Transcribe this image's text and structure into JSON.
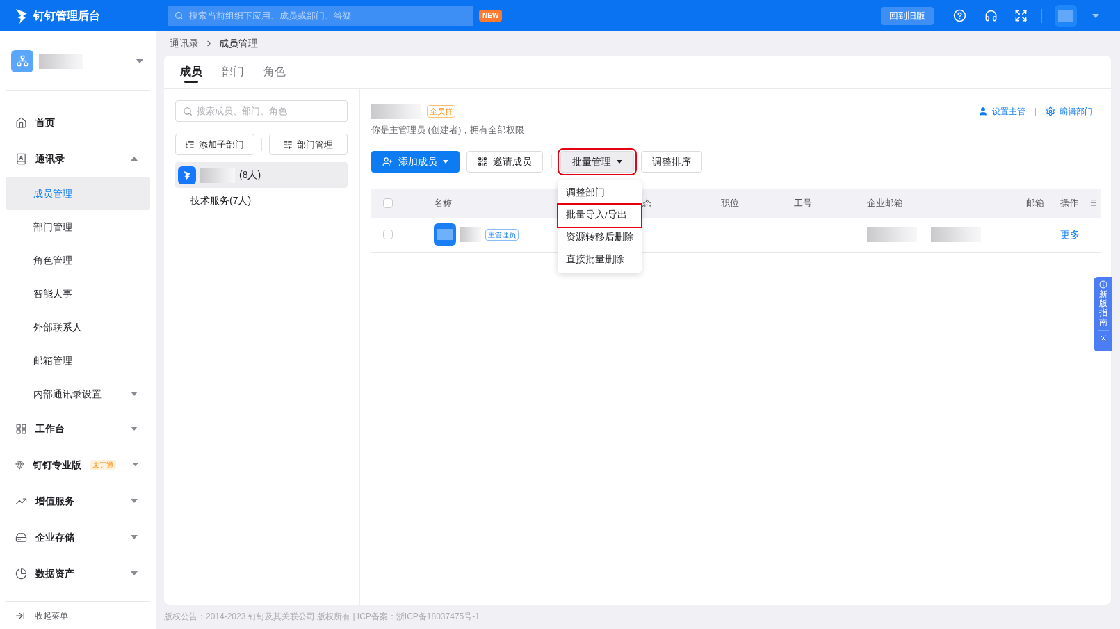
{
  "header": {
    "title": "钉钉管理后台",
    "search": {
      "placeholder": "搜索当前组织下应用、成员或部门、答疑"
    },
    "new_badge": "NEW",
    "old_version_button": "回到旧版"
  },
  "sidebar": {
    "items": [
      {
        "label": "首页",
        "kind": "link",
        "selected": false
      },
      {
        "label": "通讯录",
        "kind": "group",
        "expanded": true,
        "children": [
          {
            "label": "成员管理",
            "kind": "link",
            "selected": true
          },
          {
            "label": "部门管理",
            "kind": "link",
            "selected": false
          },
          {
            "label": "角色管理",
            "kind": "link",
            "selected": false
          },
          {
            "label": "智能人事",
            "kind": "link",
            "selected": false
          },
          {
            "label": "外部联系人",
            "kind": "link",
            "selected": false
          },
          {
            "label": "邮箱管理",
            "kind": "link",
            "selected": false
          },
          {
            "label": "内部通讯录设置",
            "kind": "group",
            "expanded": false
          }
        ]
      },
      {
        "label": "工作台",
        "kind": "group",
        "expanded": false
      },
      {
        "label": "钉钉专业版",
        "kind": "group",
        "expanded": false,
        "badge": "未开通"
      },
      {
        "label": "增值服务",
        "kind": "group",
        "expanded": false
      },
      {
        "label": "企业存储",
        "kind": "group",
        "expanded": false
      },
      {
        "label": "数据资产",
        "kind": "group",
        "expanded": false
      }
    ],
    "collapse": "收起菜单"
  },
  "breadcrumb": [
    "通讯录",
    "成员管理"
  ],
  "tabs": [
    {
      "label": "成员",
      "selected": true
    },
    {
      "label": "部门",
      "selected": false
    },
    {
      "label": "角色",
      "selected": false
    }
  ],
  "dept_panel": {
    "search": {
      "placeholder": "搜索成员、部门、角色"
    },
    "buttons": [
      "添加子部门",
      "部门管理"
    ],
    "tree": [
      {
        "label": "(8人)",
        "kind": "org",
        "selected": true
      },
      {
        "label": "技术服务(7人)",
        "kind": "dept",
        "selected": false
      }
    ]
  },
  "dept_header": {
    "tag": "全员群",
    "subtitle": "你是主管理员 (创建者)，拥有全部权限",
    "links": [
      "设置主管",
      "编辑部门"
    ]
  },
  "toolbar": [
    {
      "label": "添加成员",
      "kind": "primary",
      "highlighted": false
    },
    {
      "label": "邀请成员",
      "kind": "plain",
      "highlighted": false
    },
    {
      "label": "批量管理",
      "kind": "dropdown",
      "highlighted": true
    },
    {
      "label": "调整排序",
      "kind": "plain",
      "highlighted": false
    }
  ],
  "dropdown": {
    "items": [
      {
        "label": "调整部门",
        "highlighted": false
      },
      {
        "label": "批量导入/导出",
        "highlighted": true
      },
      {
        "label": "资源转移后删除",
        "highlighted": false
      },
      {
        "label": "直接批量删除",
        "highlighted": false
      }
    ]
  },
  "table": {
    "select_all_checked": false,
    "columns": [
      "名称",
      "态",
      "职位",
      "工号",
      "企业邮箱",
      "邮箱",
      "操作"
    ],
    "rows": [
      {
        "checked": false,
        "role_tag": "主管理员",
        "action": "更多"
      }
    ]
  },
  "footer": "版权公告：2014-2023 钉钉及其关联公司 版权所有 | ICP备案：浙ICP备18037475号-1",
  "guide": "新版指南"
}
